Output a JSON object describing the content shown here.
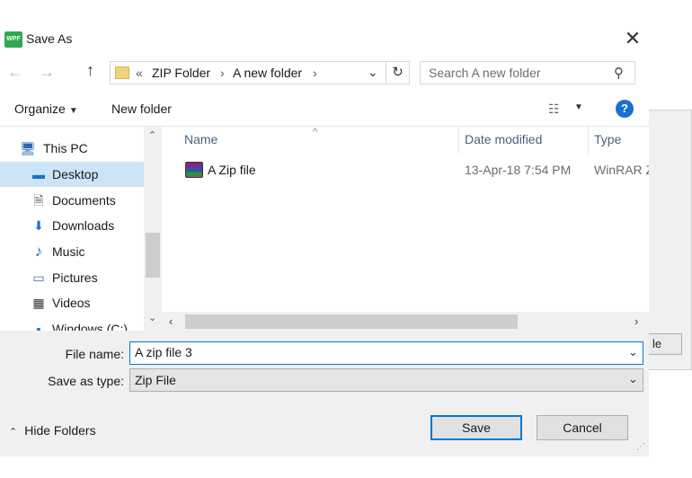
{
  "window": {
    "app_icon_text": "WPF",
    "title": "Save As",
    "close_glyph": "✕"
  },
  "navigation": {
    "back_glyph": "←",
    "forward_glyph": "→",
    "up_glyph": "↑",
    "address": {
      "overflow": "«",
      "segments": [
        "ZIP Folder",
        "A new folder"
      ],
      "separator": "›",
      "dropdown_glyph": "⌄",
      "refresh_glyph": "↻"
    },
    "search": {
      "placeholder": "Search A new folder",
      "value": ""
    }
  },
  "toolbar": {
    "organize_label": "Organize",
    "organize_arrow": "▼",
    "new_folder_label": "New folder",
    "view_glyph": "☷",
    "view_arrow": "▼",
    "help_glyph": "?"
  },
  "nav_pane": {
    "items": [
      {
        "label": "This PC",
        "icon": "computer-icon",
        "glyph": "🖥",
        "selected": false
      },
      {
        "label": "Desktop",
        "icon": "desktop-icon",
        "glyph": "▬",
        "selected": true
      },
      {
        "label": "Documents",
        "icon": "documents-icon",
        "glyph": "🗎",
        "selected": false
      },
      {
        "label": "Downloads",
        "icon": "downloads-icon",
        "glyph": "⬇",
        "selected": false
      },
      {
        "label": "Music",
        "icon": "music-icon",
        "glyph": "♪",
        "selected": false
      },
      {
        "label": "Pictures",
        "icon": "pictures-icon",
        "glyph": "▭",
        "selected": false
      },
      {
        "label": "Videos",
        "icon": "videos-icon",
        "glyph": "▦",
        "selected": false
      },
      {
        "label": "Windows (C:)",
        "icon": "drive-icon",
        "glyph": "▪",
        "selected": false
      }
    ],
    "scroll_up": "⌃",
    "scroll_down": "⌄"
  },
  "file_list": {
    "columns": [
      "Name",
      "Date modified",
      "Type"
    ],
    "sort_glyph": "^",
    "rows": [
      {
        "name": "A Zip file",
        "date_modified": "13-Apr-18 7:54 PM",
        "type": "WinRAR Z",
        "icon": "winrar-archive-icon"
      }
    ],
    "scroll_left": "‹",
    "scroll_right": "›"
  },
  "form": {
    "file_name_label": "File name:",
    "file_name_value": "A zip file 3",
    "save_as_type_label": "Save as type:",
    "save_as_type_value": "Zip File",
    "dropdown_glyph": "⌄"
  },
  "footer": {
    "hide_folders_glyph": "⌃",
    "hide_folders_label": "Hide Folders",
    "save_label": "Save",
    "cancel_label": "Cancel",
    "grip_glyph": "⋰"
  },
  "background_window": {
    "button_label": "le"
  },
  "colors": {
    "accent": "#0078d7",
    "selection": "#cce4f7",
    "help": "#1a6fd2",
    "app_icon": "#2fa84f"
  }
}
